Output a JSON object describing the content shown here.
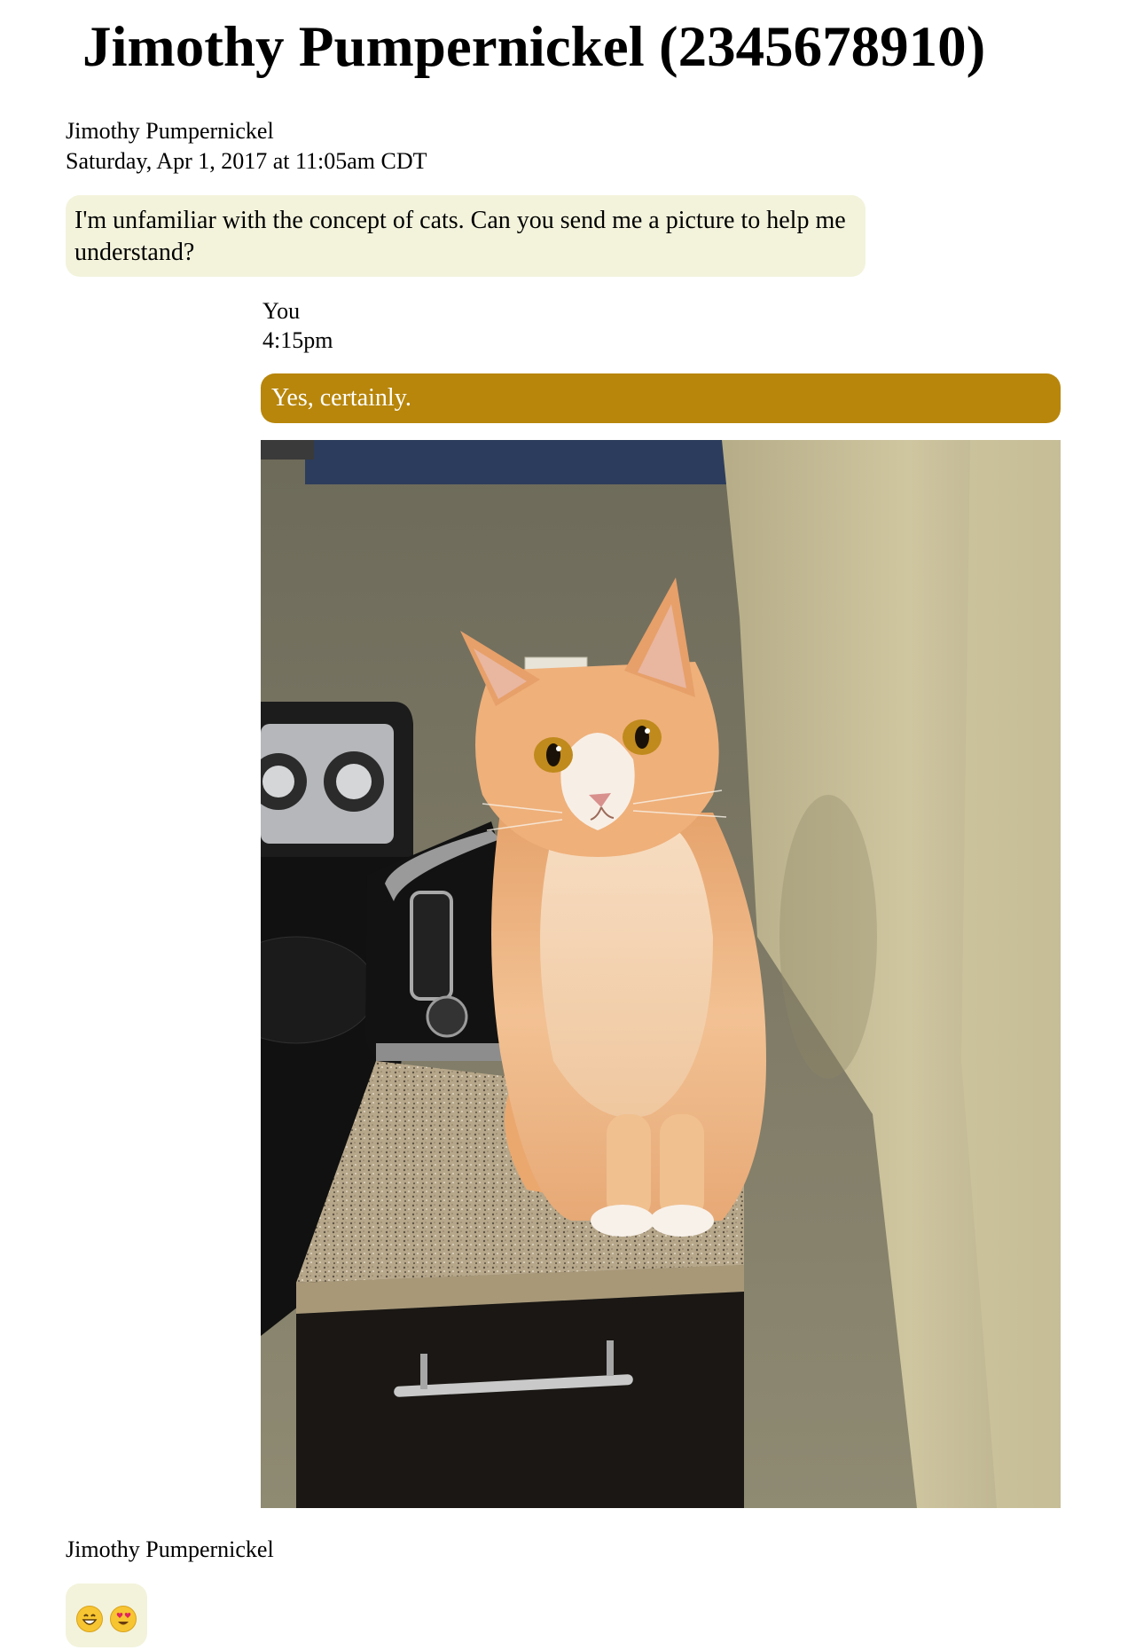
{
  "conversation": {
    "title": "Jimothy Pumpernickel (2345678910)"
  },
  "messages": [
    {
      "sender": "Jimothy Pumpernickel",
      "timestamp": "Saturday, Apr 1, 2017 at 11:05am CDT",
      "text": "I'm unfamiliar with the concept of cats. Can you send me a picture to help me understand?"
    },
    {
      "sender": "You",
      "timestamp": "4:15pm",
      "text": "Yes, certainly.",
      "attachment": "cat-photo"
    },
    {
      "sender": "Jimothy Pumpernickel",
      "emojis": [
        "grinning-face-icon",
        "heart-eyes-face-icon"
      ]
    }
  ],
  "colors": {
    "incoming_bubble": "#f3f3dc",
    "outgoing_bubble": "#b8860b",
    "outgoing_text": "#ffffff"
  }
}
